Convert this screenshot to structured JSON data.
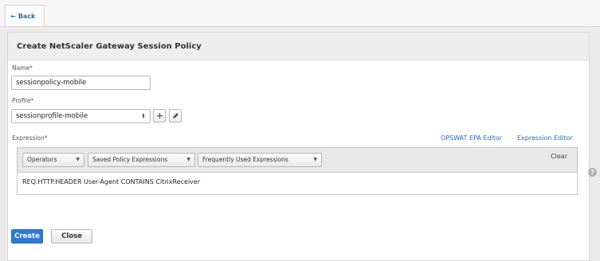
{
  "back": {
    "label": "Back",
    "arrow": "←"
  },
  "panel": {
    "title": "Create NetScaler Gateway Session Policy"
  },
  "name_field": {
    "label": "Name*",
    "value": "sessionpolicy-mobile"
  },
  "profile_field": {
    "label": "Profile*",
    "value": "sessionprofile-mobile",
    "add_icon": "plus-icon",
    "edit_icon": "pencil-icon"
  },
  "expression": {
    "label": "Expression*",
    "links": {
      "opswat": "OPSWAT EPA Editor",
      "editor": "Expression Editor"
    },
    "toolbar": {
      "operators": "Operators",
      "saved": "Saved Policy Expressions",
      "frequent": "Frequently Used Expressions",
      "clear": "Clear"
    },
    "value": "REQ.HTTP.HEADER User-Agent CONTAINS CitrixReceiver"
  },
  "help_icon": "?",
  "buttons": {
    "create": "Create",
    "close": "Close"
  },
  "colors": {
    "accent": "#1f6fb5",
    "primary_button": "#2f7bd1"
  }
}
